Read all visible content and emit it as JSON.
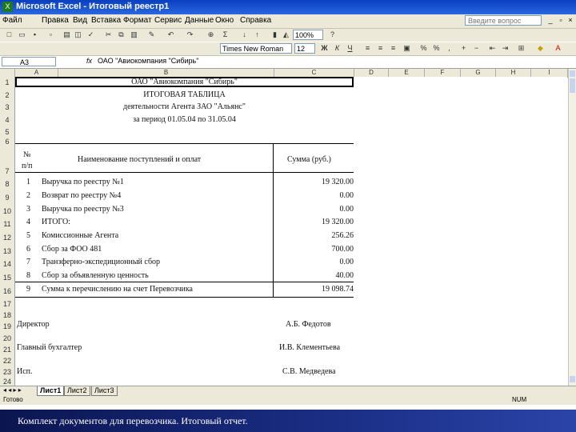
{
  "window": {
    "title": "Microsoft Excel - Итоговый реестр1",
    "app_icon": "excel-icon"
  },
  "menu": {
    "items": [
      "Файл",
      "Правка",
      "Вид",
      "Вставка",
      "Формат",
      "Сервис",
      "Данные",
      "Окно",
      "Справка"
    ],
    "help_placeholder": "Введите вопрос",
    "window_controls": [
      "_",
      "▫",
      "×"
    ]
  },
  "toolbar1": {
    "zoom": "100%"
  },
  "toolbar2": {
    "font_name": "Times New Roman",
    "font_size": "12"
  },
  "formula_bar": {
    "name_box": "A3",
    "fx": "fx",
    "content": "ОАО \"Авиокомпания \"Сибирь\""
  },
  "columns": [
    "A",
    "B",
    "C",
    "D",
    "E",
    "F",
    "G",
    "H",
    "I"
  ],
  "rows": [
    "1",
    "2",
    "3",
    "4",
    "5",
    "6",
    "7",
    "8",
    "9",
    "10",
    "11",
    "12",
    "13",
    "14",
    "15",
    "16",
    "17",
    "18",
    "19",
    "20",
    "21",
    "22",
    "23",
    "24"
  ],
  "sheet": {
    "title1": "ОАО \"Авиокомпания \"Сибирь\"",
    "title2": "ИТОГОВАЯ ТАБЛИЦА",
    "title3": "деятельности Агента ЗАО \"Альянс\"",
    "title4": "за период 01.05.04 по 31.05.04",
    "hdr_num": "№",
    "hdr_num2": "п/п",
    "hdr_name": "Наименование поступлений и оплат",
    "hdr_sum": "Сумма (руб.)",
    "rows": [
      {
        "n": "1",
        "name": "Выручка по реестру №1",
        "sum": "19 320.00"
      },
      {
        "n": "2",
        "name": "Возврат по реестру №4",
        "sum": "0.00"
      },
      {
        "n": "3",
        "name": "Выручка по реестру №3",
        "sum": "0.00"
      },
      {
        "n": "4",
        "name": "ИТОГО:",
        "sum": "19 320.00"
      },
      {
        "n": "5",
        "name": "Комиссионные Агента",
        "sum": "256.26"
      },
      {
        "n": "6",
        "name": "Сбор за ФОО 481",
        "sum": "700.00"
      },
      {
        "n": "7",
        "name": "Транзферно-экспедиционный сбор",
        "sum": "0.00"
      },
      {
        "n": "8",
        "name": "Сбор за объявленную ценность",
        "sum": "40.00"
      },
      {
        "n": "9",
        "name": "Сумма к перечислению на счет Перевозчика",
        "sum": "19 098.74"
      }
    ],
    "sign1_role": "Директор",
    "sign1_name": "А.Б. Федотов",
    "sign2_role": "Главный бухгалтер",
    "sign2_name": "И.В. Клементьева",
    "sign3_role": "Исп.",
    "sign3_name": "С.В. Медведева"
  },
  "tabs": [
    "Лист1",
    "Лист2",
    "Лист3"
  ],
  "status": {
    "left": "Готово",
    "right": "NUM"
  },
  "caption": "Комплект документов для перевозчика. Итоговый отчет."
}
